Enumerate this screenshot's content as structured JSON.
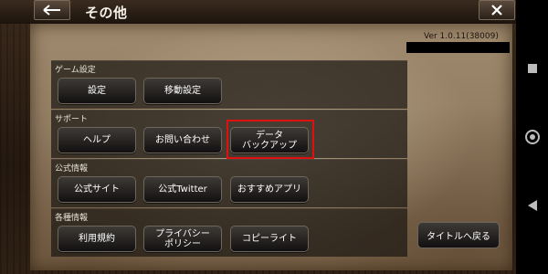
{
  "header": {
    "title": "その他",
    "back_icon": "arrow-left-icon",
    "close_icon": "close-icon"
  },
  "version": "Ver 1.0.11(38009)",
  "sections": [
    {
      "label": "ゲーム設定",
      "buttons": [
        "設定",
        "移動設定"
      ]
    },
    {
      "label": "サポート",
      "buttons": [
        "ヘルプ",
        "お問い合わせ",
        "データ\nバックアップ"
      ]
    },
    {
      "label": "公式情報",
      "buttons": [
        "公式サイト",
        "公式Twitter",
        "おすすめアプリ"
      ]
    },
    {
      "label": "各種情報",
      "buttons": [
        "利用規約",
        "プライバシー\nポリシー",
        "コピーライト"
      ]
    }
  ],
  "return_title": "タイトルへ戻る",
  "highlight_color": "#e01010",
  "android_nav": [
    "square-recents-icon",
    "circle-home-icon",
    "triangle-back-icon"
  ]
}
